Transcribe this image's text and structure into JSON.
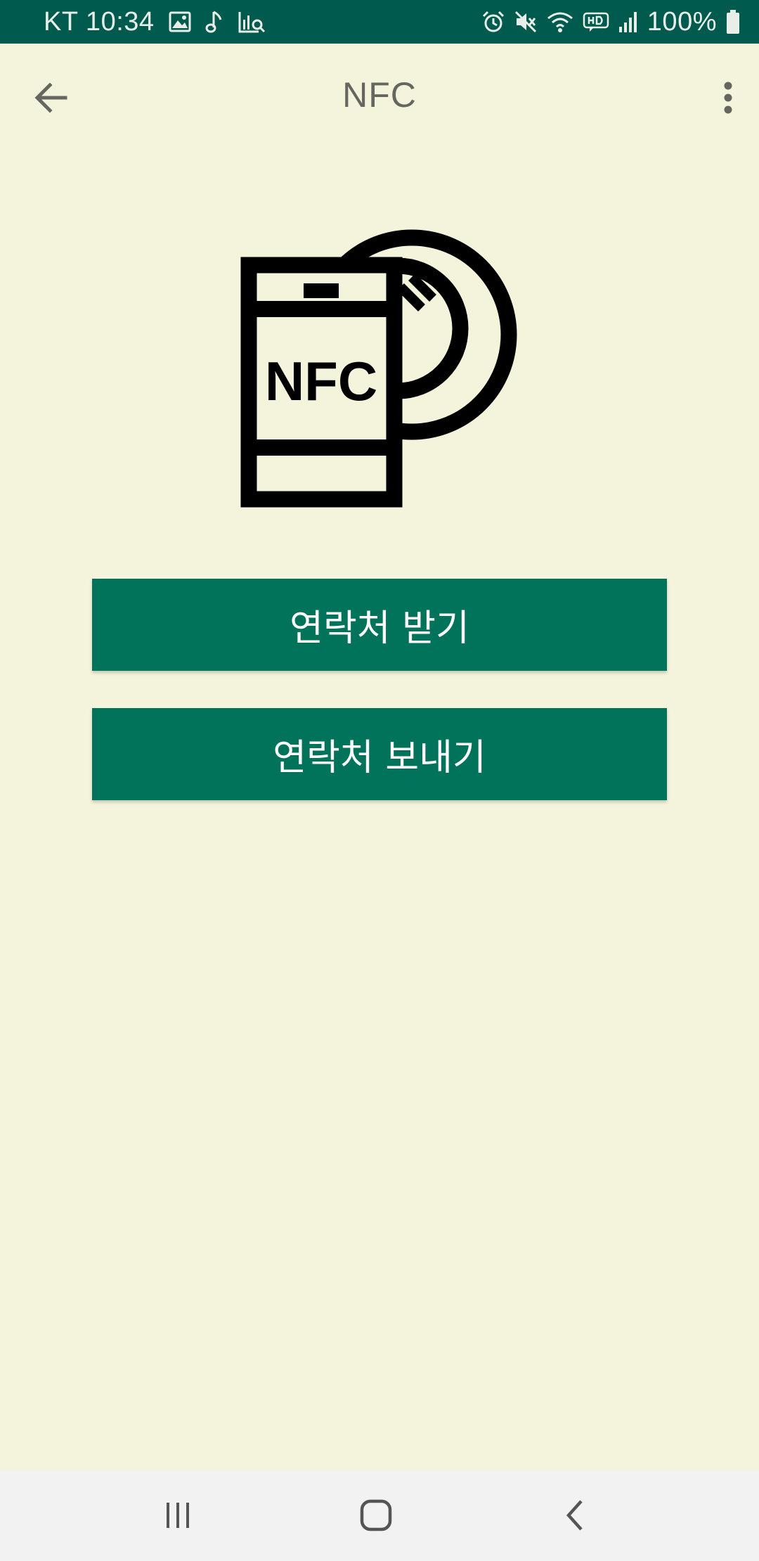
{
  "status_bar": {
    "carrier_time": "KT 10:34",
    "battery": "100%",
    "left_icons": [
      "image-icon",
      "music-note-icon",
      "chart-search-icon"
    ],
    "right_icons": [
      "alarm-icon",
      "mute-icon",
      "wifi-icon",
      "hd-voice-icon",
      "signal-icon",
      "battery-icon"
    ]
  },
  "app_bar": {
    "title": "NFC",
    "back_icon": "arrow-left-icon",
    "menu_icon": "more-vert-icon"
  },
  "illustration": {
    "label": "NFC",
    "icon": "nfc-phone-icon"
  },
  "buttons": {
    "receive_label": "연락처 받기",
    "send_label": "연락처 보내기"
  },
  "nav_bar": {
    "icons": [
      "recent-apps-icon",
      "home-icon",
      "back-icon"
    ]
  },
  "colors": {
    "status_bar": "#005a4e",
    "background": "#f4f4dc",
    "button": "#00735a",
    "title_text": "#666660",
    "nav_bar": "#f2f2f2"
  }
}
